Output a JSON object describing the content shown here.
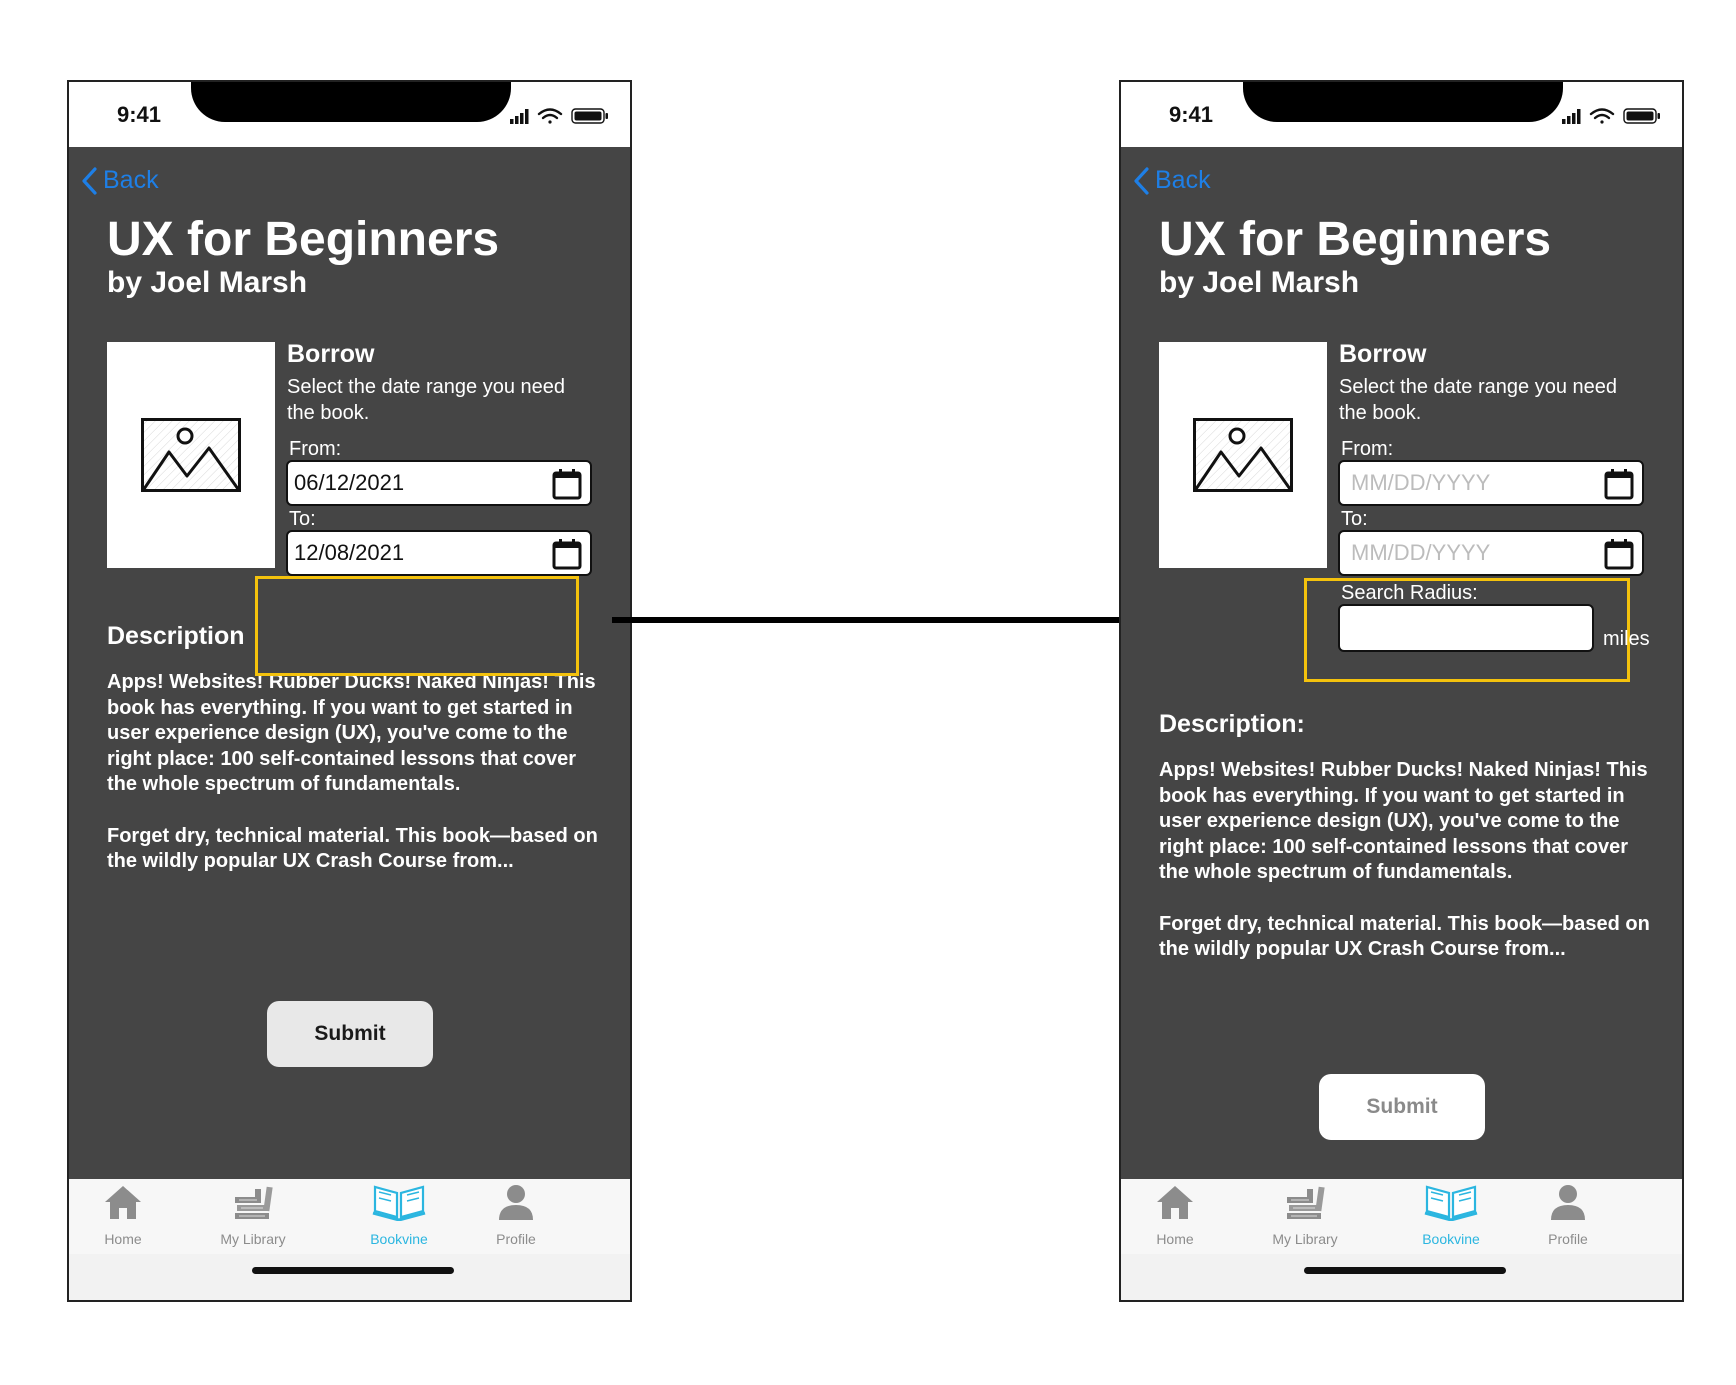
{
  "status_bar": {
    "time": "9:41"
  },
  "nav": {
    "back_label": "Back"
  },
  "book": {
    "title": "UX for Beginners",
    "author": "by Joel Marsh",
    "cover_icon": "image-placeholder-icon"
  },
  "borrow": {
    "heading": "Borrow",
    "instructions": "Select the date range you need the book.",
    "from_label": "From:",
    "to_label": "To:"
  },
  "left_screen": {
    "from_value": "06/12/2021",
    "to_value": "12/08/2021",
    "description_heading": "Description"
  },
  "right_screen": {
    "date_placeholder": "MM/DD/YYYY",
    "search_radius_label": "Search Radius:",
    "search_radius_value": "",
    "search_radius_unit": "miles",
    "description_heading": "Description:"
  },
  "description": {
    "paragraph_1": "Apps! Websites! Rubber Ducks! Naked Ninjas! This book has everything. If you want to get started in user experience design (UX), you've come to the right place: 100 self-contained lessons that cover the whole spectrum of fundamentals.",
    "paragraph_2": "Forget dry, technical material. This book—based on the wildly popular UX Crash Course from..."
  },
  "actions": {
    "submit_label": "Submit"
  },
  "tab_bar": {
    "items": [
      {
        "label": "Home",
        "icon": "home-icon"
      },
      {
        "label": "My Library",
        "icon": "library-icon"
      },
      {
        "label": "Bookvine",
        "icon": "open-book-icon",
        "active": true
      },
      {
        "label": "Profile",
        "icon": "person-icon"
      }
    ]
  },
  "colors": {
    "screen_bg": "#454545",
    "link_blue": "#1e7fe6",
    "active_tab": "#2bb6e0",
    "highlight": "#f4c20d"
  }
}
